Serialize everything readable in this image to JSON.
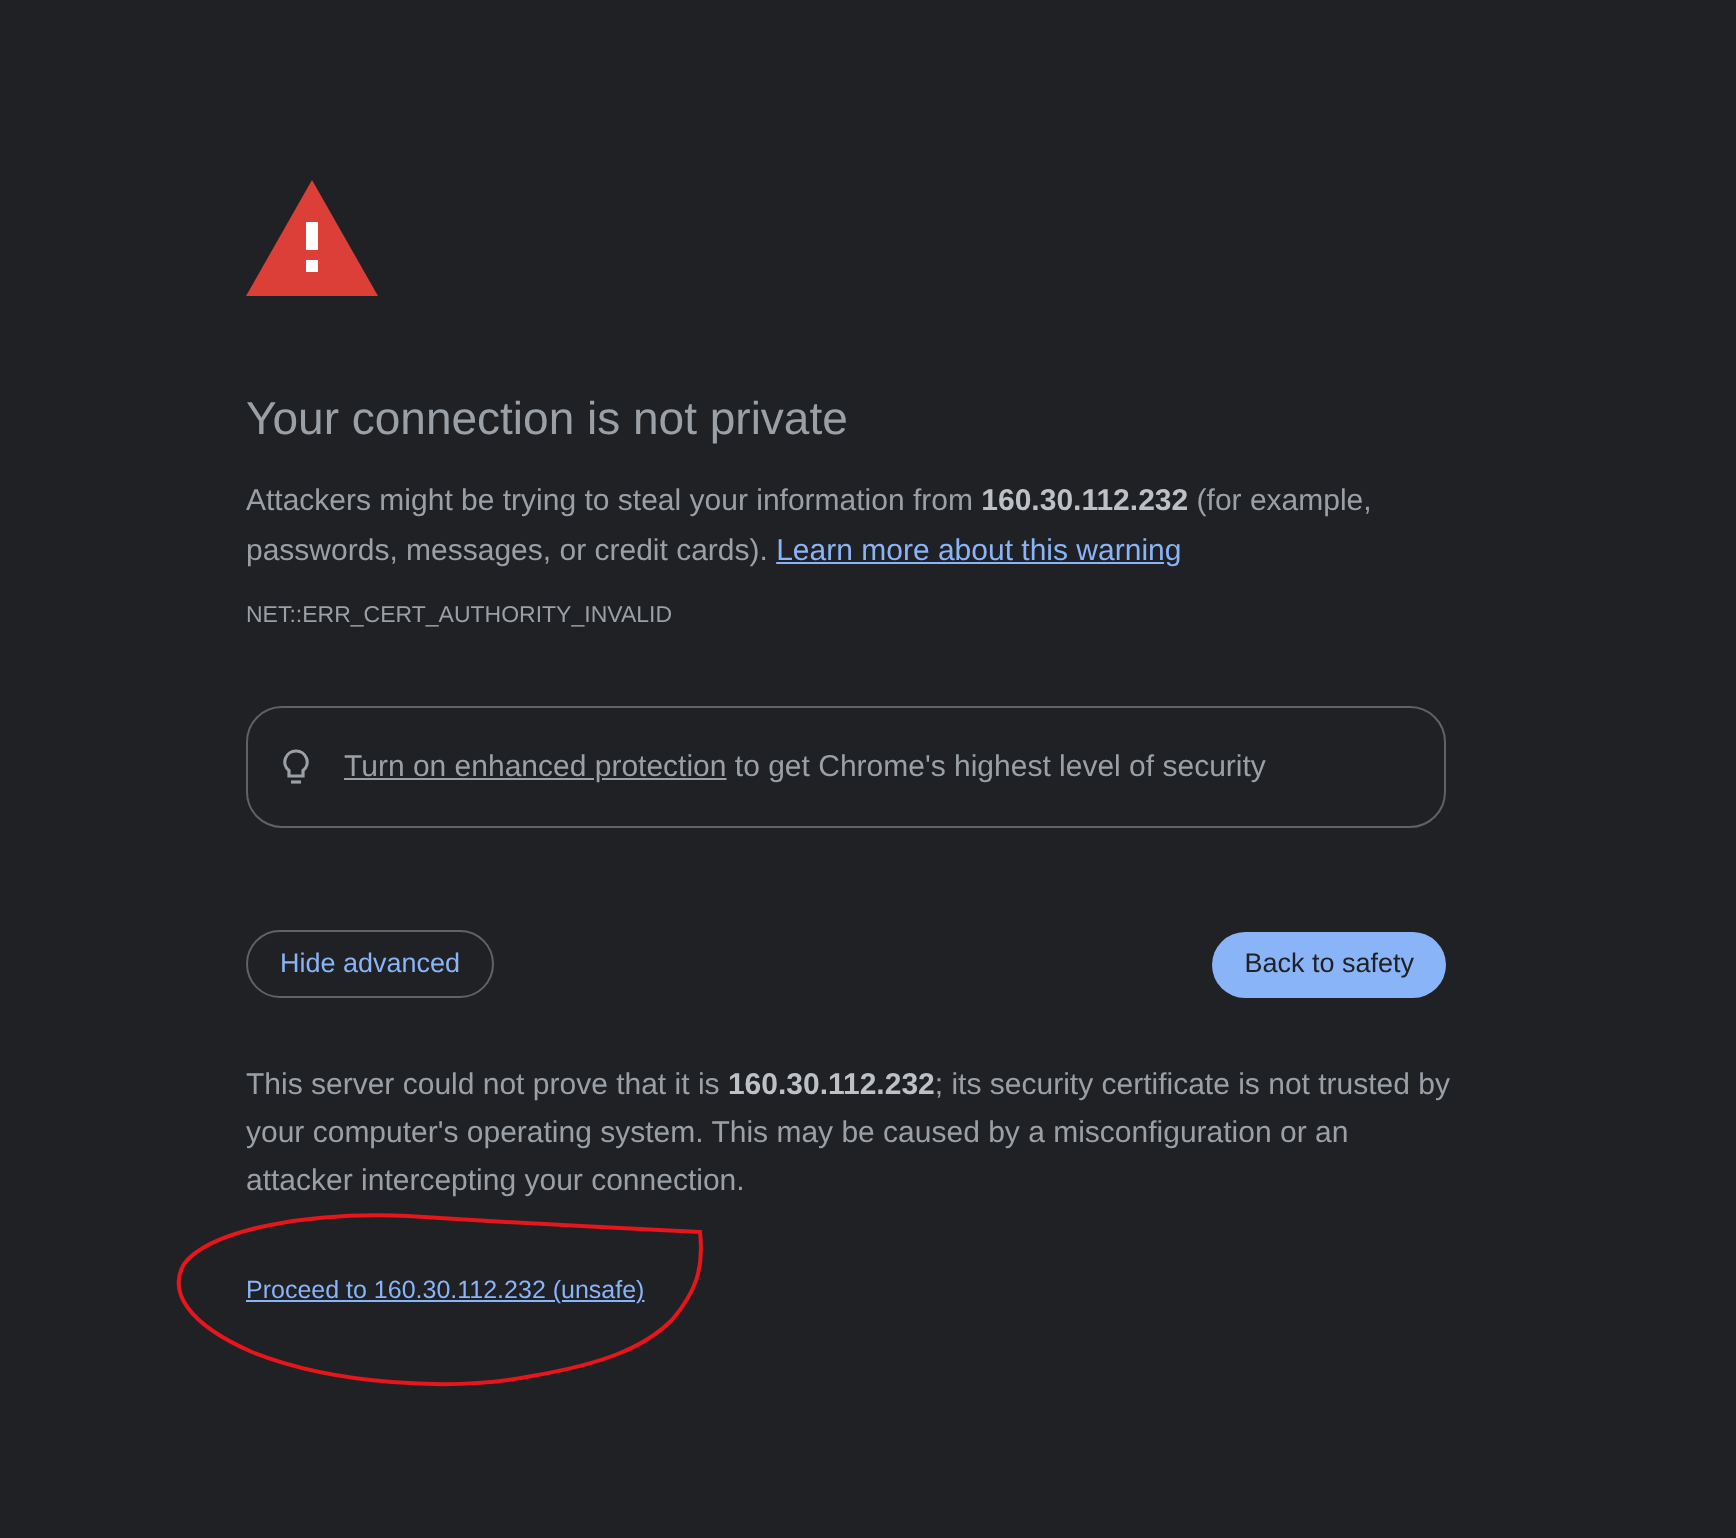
{
  "heading": "Your connection is not private",
  "message": {
    "text": "Attackers might be trying to steal your information from **160.30.112.232** (for example, passwords, messages, or credit cards).",
    "link": "Learn more about this warning"
  },
  "error_code": "NET::ERR_CERT_AUTHORITY_INVALID",
  "enhanced_protection": {
    "link": "Turn on enhanced protection",
    "text": "to get Chrome's highest level of security"
  },
  "buttons": [
    {
      "label": "Hide advanced",
      "kind": "outline"
    },
    {
      "label": "Back to safety",
      "kind": "primary"
    }
  ],
  "details": "This server could not prove that it is **160.30.112.232**; its security certificate is not trusted by your computer's operating system. This may be caused by a misconfiguration or an attacker intercepting your connection.",
  "proceed_link": "Proceed to 160.30.112.232 (unsafe)"
}
